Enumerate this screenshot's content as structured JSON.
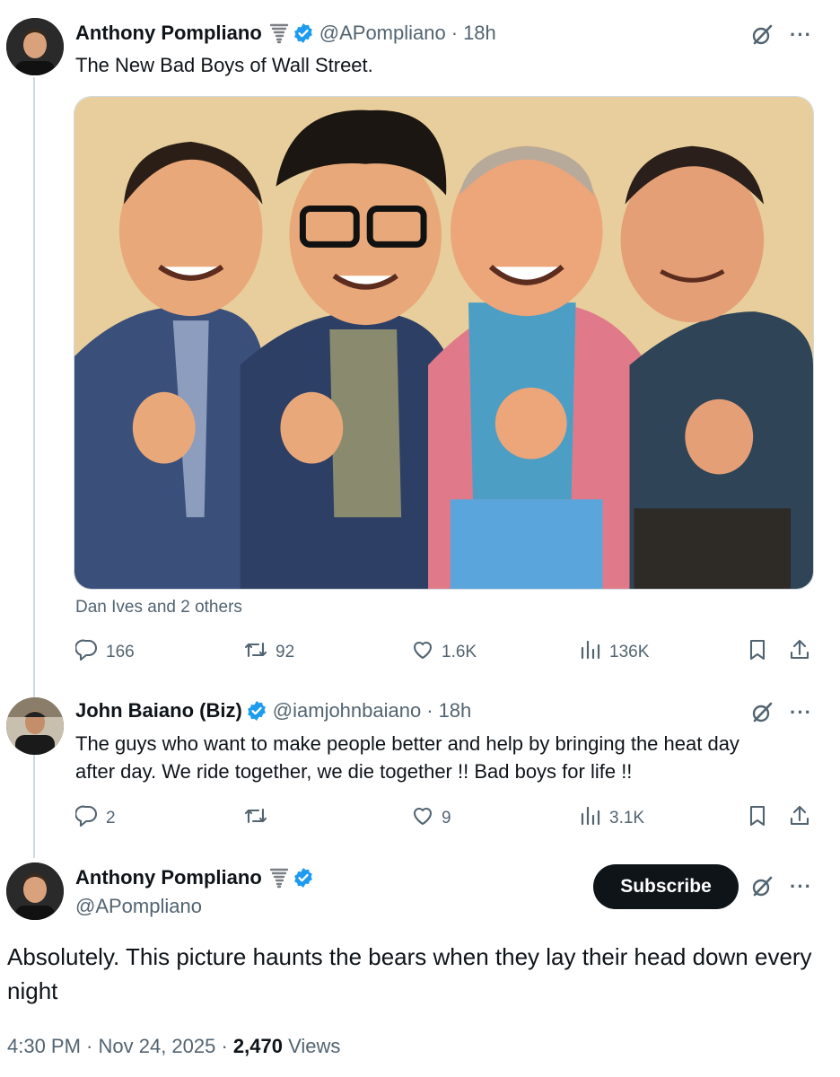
{
  "tweet1": {
    "name": "Anthony Pompliano",
    "handle": "@APompliano",
    "time": "18h",
    "text": "The New Bad Boys of Wall Street.",
    "liked_by": "Dan Ives and 2 others",
    "replies": "166",
    "reposts": "92",
    "likes": "1.6K",
    "views": "136K"
  },
  "tweet2": {
    "name": "John Baiano (Biz)",
    "handle": "@iamjohnbaiano",
    "time": "18h",
    "text_line1": "The guys who want to make people better and help by bringing the heat day",
    "text_line2": "after day. We ride together, we die together !! Bad boys for life !!",
    "replies": "2",
    "reposts": "",
    "likes": "9",
    "views": "3.1K"
  },
  "tweet3": {
    "name": "Anthony Pompliano",
    "handle": "@APompliano",
    "subscribe_label": "Subscribe",
    "text": "Absolutely. This picture haunts the bears when they lay their head down every night",
    "timestamp": "4:30 PM · Nov 24, 2025 · ",
    "views_count": "2,470",
    "views_label": " Views"
  },
  "separator": "·",
  "more": "···",
  "colors": {
    "verified": "#1d9bf0",
    "muted": "#536471",
    "text": "#0f1419",
    "subscribe_bg": "#0f1419"
  },
  "icons": [
    "tornado-icon",
    "verified-badge-icon",
    "grok-icon",
    "more-icon",
    "reply-icon",
    "repost-icon",
    "like-icon",
    "views-icon",
    "bookmark-icon",
    "share-icon"
  ]
}
